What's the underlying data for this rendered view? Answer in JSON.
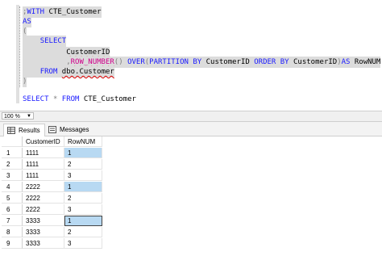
{
  "editor": {
    "lines": [
      {
        "segments": [
          {
            "t": ";",
            "c": "gray"
          },
          {
            "t": "WITH",
            "c": "kw"
          },
          {
            "t": " CTE_Customer",
            "c": ""
          }
        ]
      },
      {
        "segments": [
          {
            "t": "AS",
            "c": "kw"
          }
        ]
      },
      {
        "segments": [
          {
            "t": "(",
            "c": "gray"
          }
        ]
      },
      {
        "segments": [
          {
            "t": "    "
          },
          {
            "t": "SELECT",
            "c": "kw"
          }
        ]
      },
      {
        "segments": [
          {
            "t": "          "
          },
          {
            "t": "CustomerID",
            "c": "squig"
          }
        ]
      },
      {
        "segments": [
          {
            "t": "          "
          },
          {
            "t": ",",
            "c": "gray"
          },
          {
            "t": "ROW_NUMBER",
            "c": "fn squig"
          },
          {
            "t": "() ",
            "c": "gray"
          },
          {
            "t": "OVER",
            "c": "kw"
          },
          {
            "t": "(",
            "c": "gray"
          },
          {
            "t": "PARTITION BY",
            "c": "kw"
          },
          {
            "t": " CustomerID ",
            "c": ""
          },
          {
            "t": "ORDER BY",
            "c": "kw"
          },
          {
            "t": " CustomerID",
            "": ""
          },
          {
            "t": ")",
            "c": "gray"
          },
          {
            "t": "AS",
            "c": "kw"
          },
          {
            "t": " RowNUM",
            "c": ""
          }
        ]
      },
      {
        "segments": [
          {
            "t": "    "
          },
          {
            "t": "FROM",
            "c": "kw"
          },
          {
            "t": " "
          },
          {
            "t": "dbo.Customer",
            "c": "squig"
          }
        ]
      },
      {
        "segments": [
          {
            "t": ")",
            "c": "gray"
          }
        ]
      },
      {
        "segments": [
          {
            "t": ""
          }
        ]
      },
      {
        "segments": [
          {
            "t": "SELECT",
            "c": "kw"
          },
          {
            "t": " "
          },
          {
            "t": "*",
            "c": "gray"
          },
          {
            "t": " "
          },
          {
            "t": "FROM",
            "c": "kw"
          },
          {
            "t": " CTE_Customer",
            "c": ""
          }
        ]
      }
    ]
  },
  "zoom": {
    "value": "100 %"
  },
  "tabs": {
    "results": "Results",
    "messages": "Messages"
  },
  "grid": {
    "columns": [
      "CustomerID",
      "RowNUM"
    ],
    "rows": [
      {
        "n": "1",
        "id": "1111",
        "rn": "1",
        "hl": true
      },
      {
        "n": "2",
        "id": "1111",
        "rn": "2",
        "hl": false
      },
      {
        "n": "3",
        "id": "1111",
        "rn": "3",
        "hl": false
      },
      {
        "n": "4",
        "id": "2222",
        "rn": "1",
        "hl": true
      },
      {
        "n": "5",
        "id": "2222",
        "rn": "2",
        "hl": false
      },
      {
        "n": "6",
        "id": "2222",
        "rn": "3",
        "hl": false
      },
      {
        "n": "7",
        "id": "3333",
        "rn": "1",
        "hl": true,
        "focus": true
      },
      {
        "n": "8",
        "id": "3333",
        "rn": "2",
        "hl": false
      },
      {
        "n": "9",
        "id": "3333",
        "rn": "3",
        "hl": false
      }
    ]
  }
}
